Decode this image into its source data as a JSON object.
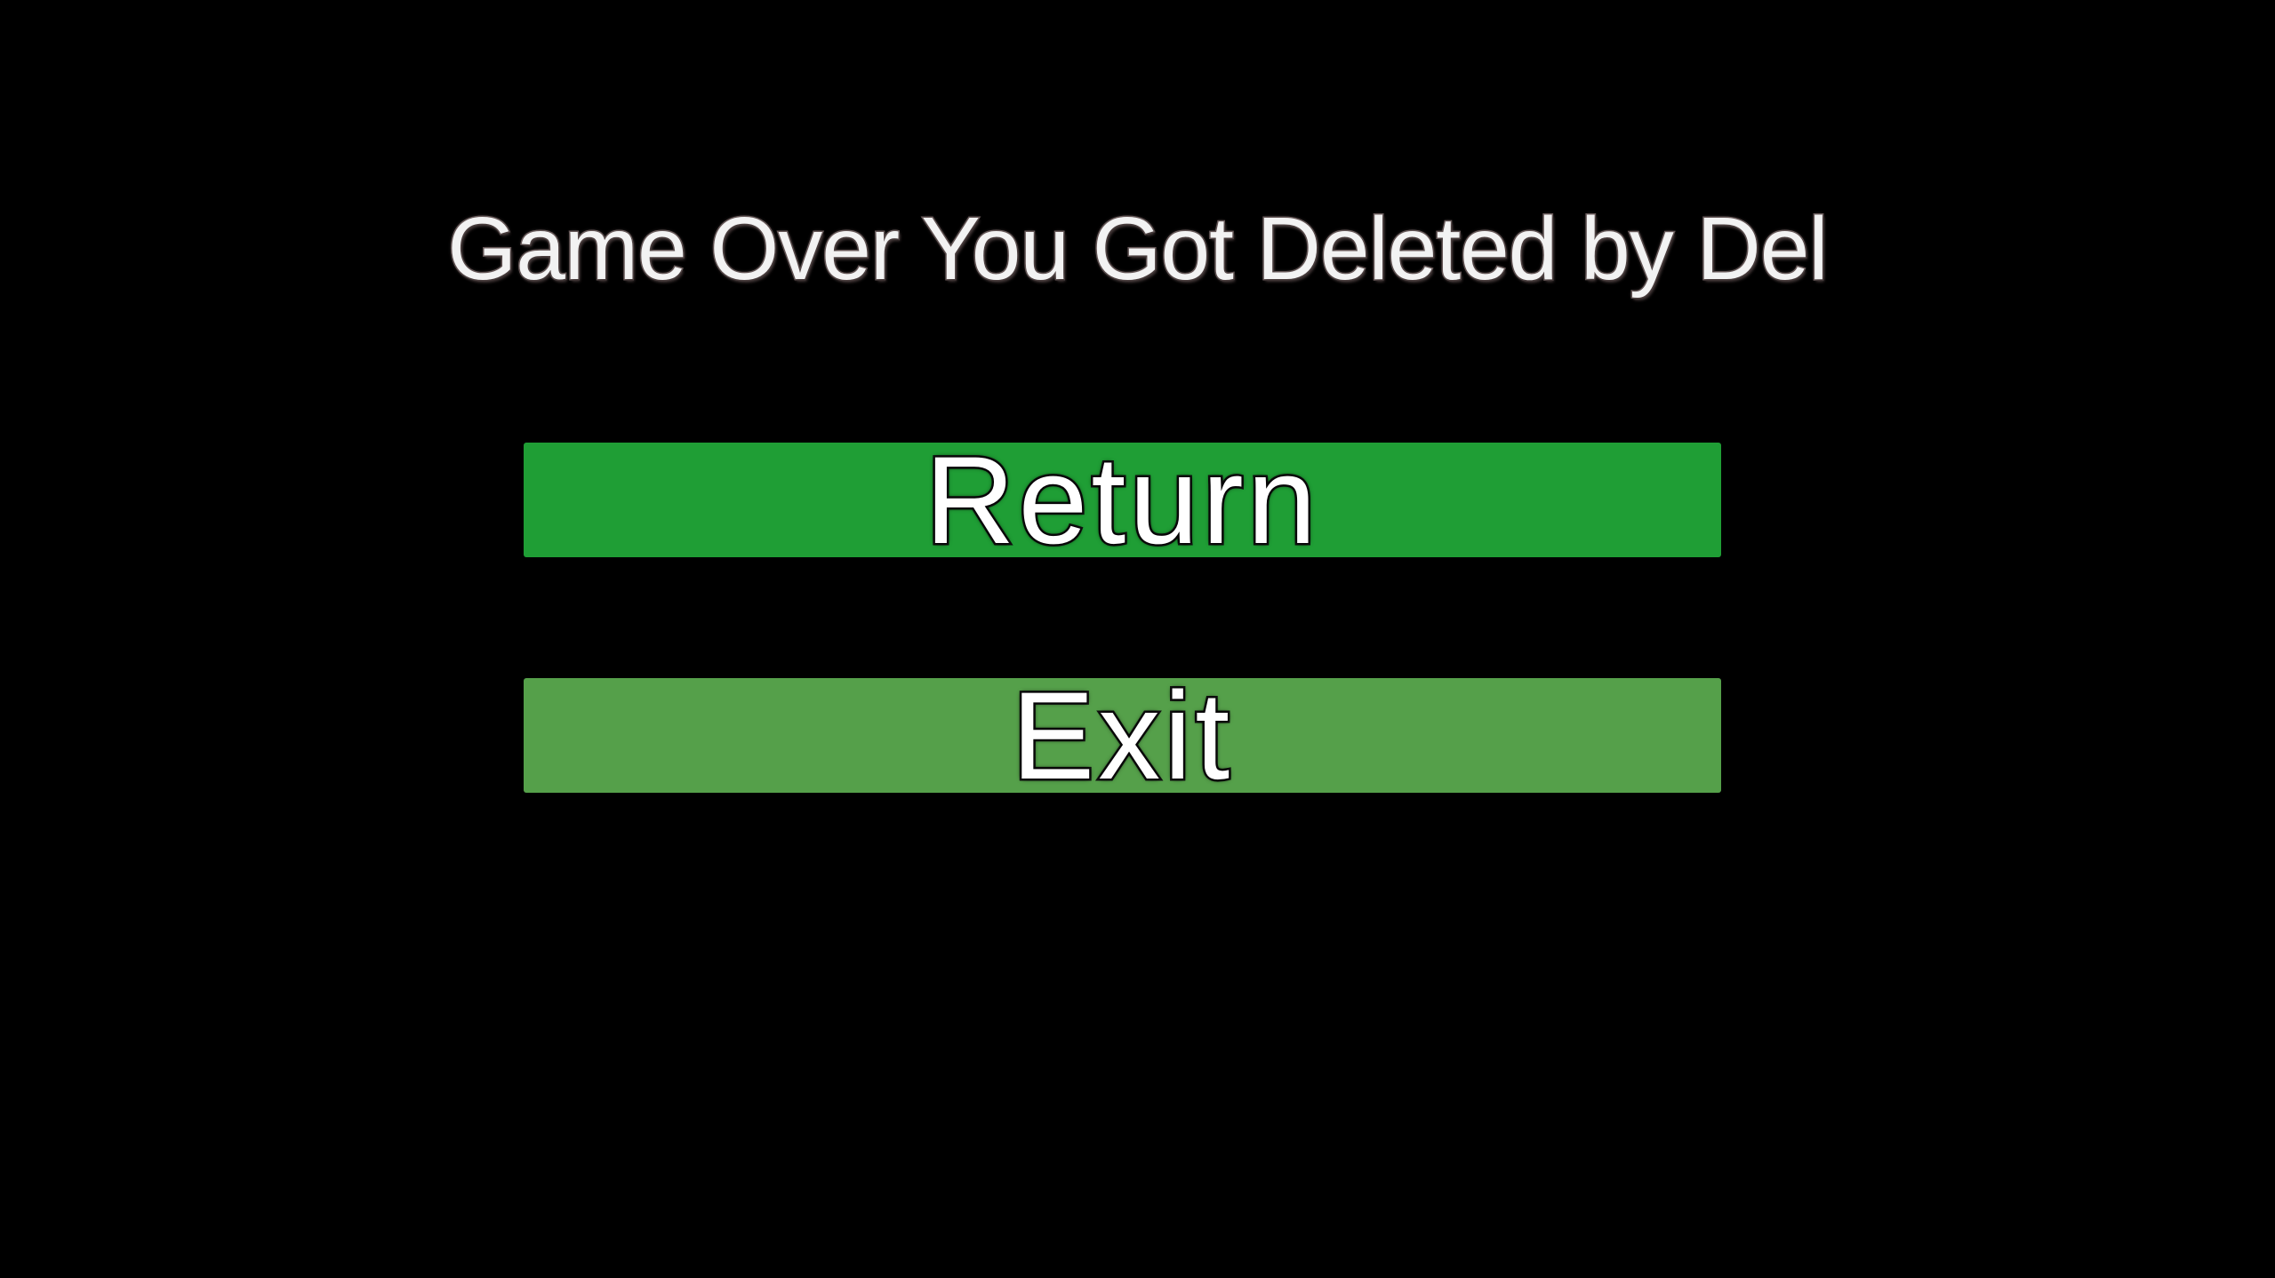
{
  "title": "Game Over You Got Deleted by Del",
  "buttons": {
    "return_label": "Return",
    "exit_label": "Exit"
  },
  "colors": {
    "background": "#000000",
    "return_button": "#1f9e35",
    "exit_button": "#55a04a"
  }
}
